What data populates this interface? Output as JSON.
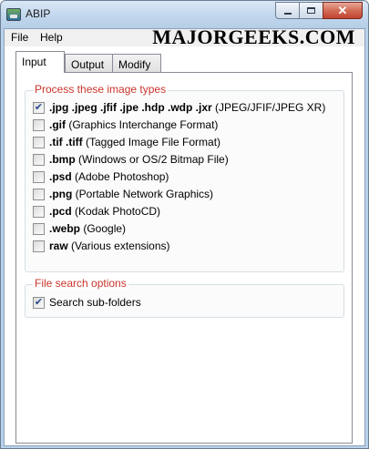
{
  "window": {
    "title": "ABIP",
    "minimize_glyph": "",
    "maximize_glyph": "",
    "close_glyph": "✕"
  },
  "menu": [
    {
      "label": "File"
    },
    {
      "label": "Help"
    }
  ],
  "watermark": "MAJORGEEKS.COM",
  "tabs": [
    {
      "label": "Input",
      "active": true
    },
    {
      "label": "Output",
      "active": false
    },
    {
      "label": "Modify",
      "active": false
    }
  ],
  "image_types": {
    "title": "Process these image types",
    "items": [
      {
        "ext": ".jpg .jpeg .jfif .jpe .hdp .wdp .jxr",
        "desc": " (JPEG/JFIF/JPEG XR)",
        "checked": true
      },
      {
        "ext": ".gif",
        "desc": " (Graphics Interchange Format)",
        "checked": false
      },
      {
        "ext": ".tif .tiff",
        "desc": " (Tagged Image File Format)",
        "checked": false
      },
      {
        "ext": ".bmp",
        "desc": " (Windows or OS/2 Bitmap File)",
        "checked": false
      },
      {
        "ext": ".psd",
        "desc": " (Adobe Photoshop)",
        "checked": false
      },
      {
        "ext": ".png",
        "desc": " (Portable Network Graphics)",
        "checked": false
      },
      {
        "ext": ".pcd",
        "desc": " (Kodak PhotoCD)",
        "checked": false
      },
      {
        "ext": ".webp",
        "desc": " (Google)",
        "checked": false
      },
      {
        "ext": "raw",
        "desc": " (Various extensions)",
        "checked": false
      }
    ]
  },
  "search_options": {
    "title": "File search options",
    "items": [
      {
        "label": "Search sub-folders",
        "checked": true
      }
    ]
  },
  "check_glyph": "✔",
  "colors": {
    "group_title": "#c8342a",
    "titlebar": "#c4d8ee"
  }
}
